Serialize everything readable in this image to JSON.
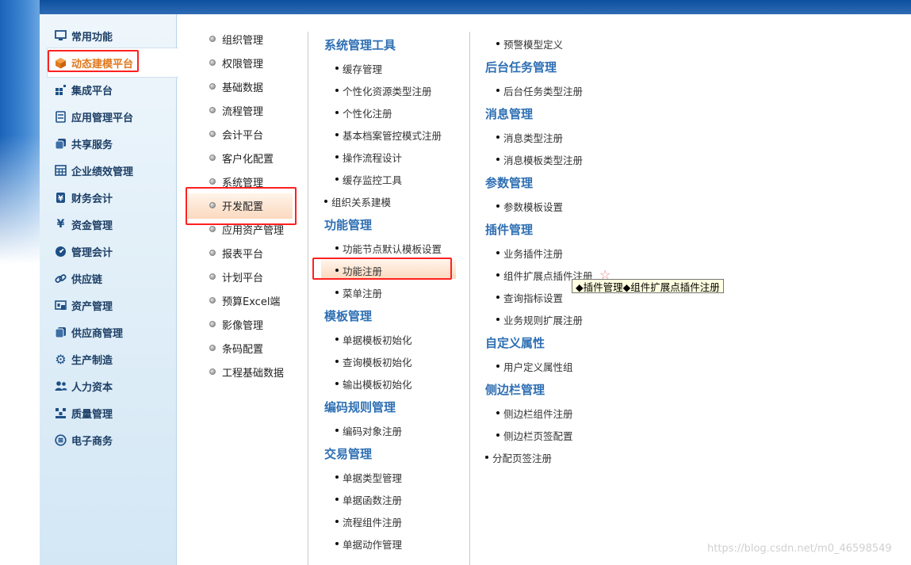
{
  "sidebar": {
    "items": [
      {
        "label": "常用功能",
        "icon": "monitor-icon"
      },
      {
        "label": "动态建模平台",
        "icon": "cube-icon",
        "active": true
      },
      {
        "label": "集成平台",
        "icon": "grid-icon"
      },
      {
        "label": "应用管理平台",
        "icon": "server-icon"
      },
      {
        "label": "共享服务",
        "icon": "share-icon"
      },
      {
        "label": "企业绩效管理",
        "icon": "table-icon"
      },
      {
        "label": "财务会计",
        "icon": "finance-icon"
      },
      {
        "label": "资金管理",
        "icon": "yen-icon"
      },
      {
        "label": "管理会计",
        "icon": "gauge-icon"
      },
      {
        "label": "供应链",
        "icon": "link-icon"
      },
      {
        "label": "资产管理",
        "icon": "asset-icon"
      },
      {
        "label": "供应商管理",
        "icon": "supplier-icon"
      },
      {
        "label": "生产制造",
        "icon": "gear-icon"
      },
      {
        "label": "人力资本",
        "icon": "people-icon"
      },
      {
        "label": "质量管理",
        "icon": "quality-icon"
      },
      {
        "label": "电子商务",
        "icon": "ecommerce-icon"
      }
    ]
  },
  "column1": {
    "items": [
      "组织管理",
      "权限管理",
      "基础数据",
      "流程管理",
      "会计平台",
      "客户化配置",
      "系统管理",
      "开发配置",
      "应用资产管理",
      "报表平台",
      "计划平台",
      "预算Excel端",
      "影像管理",
      "条码配置",
      "工程基础数据"
    ],
    "active_label": "开发配置"
  },
  "column2": {
    "sections": [
      {
        "title": "系统管理工具",
        "links": [
          "缓存管理",
          "个性化资源类型注册",
          "个性化注册",
          "基本档案管控模式注册",
          "操作流程设计",
          "缓存监控工具"
        ]
      },
      {
        "title": "",
        "links": [
          "组织关系建模"
        ]
      },
      {
        "title": "功能管理",
        "links": [
          "功能节点默认模板设置",
          "功能注册",
          "菜单注册"
        ]
      },
      {
        "title": "模板管理",
        "links": [
          "单据模板初始化",
          "查询模板初始化",
          "输出模板初始化"
        ]
      },
      {
        "title": "编码规则管理",
        "links": [
          "编码对象注册"
        ]
      },
      {
        "title": "交易管理",
        "links": [
          "单据类型管理",
          "单据函数注册",
          "流程组件注册",
          "单据动作管理"
        ]
      }
    ]
  },
  "column3": {
    "sections": [
      {
        "title": "",
        "links": [
          "预警模型定义"
        ]
      },
      {
        "title": "后台任务管理",
        "links": [
          "后台任务类型注册"
        ]
      },
      {
        "title": "消息管理",
        "links": [
          "消息类型注册",
          "消息模板类型注册"
        ]
      },
      {
        "title": "参数管理",
        "links": [
          "参数模板设置"
        ]
      },
      {
        "title": "插件管理",
        "links": [
          "业务插件注册",
          "组件扩展点插件注册",
          "查询指标设置",
          "业务规则扩展注册"
        ]
      },
      {
        "title": "自定义属性",
        "links": [
          "用户定义属性组"
        ]
      },
      {
        "title": "侧边栏管理",
        "links": [
          "侧边栏组件注册",
          "侧边栏页签配置"
        ]
      },
      {
        "title": "",
        "links": [
          "分配页签注册"
        ]
      }
    ]
  },
  "tooltip": "◆插件管理◆组件扩展点插件注册",
  "star": "☆",
  "watermark": "https://blog.csdn.net/m0_46598549",
  "colors": {
    "accent": "#2e6fb3",
    "active_text": "#e0781c",
    "highlight_border": "#ff2020"
  }
}
